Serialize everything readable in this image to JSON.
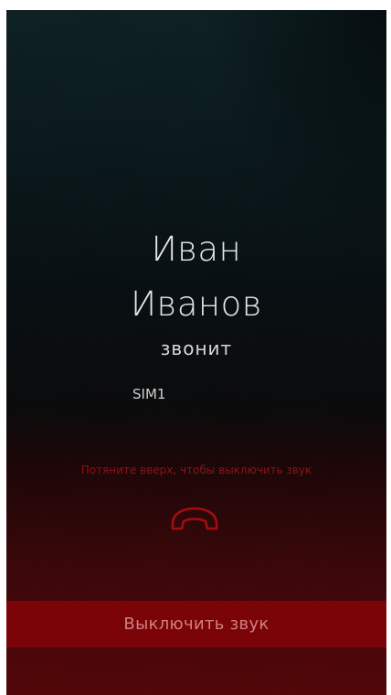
{
  "caller": {
    "first_name": "Иван",
    "last_name": "Иванов",
    "status": "звонит",
    "sim": "SIM1"
  },
  "gesture": {
    "hint": "Потяните вверх, чтобы выключить звук",
    "icon": "phone-hangup-icon"
  },
  "actions": {
    "mute_label": "Выключить звук"
  },
  "colors": {
    "accent_red": "#7a0407",
    "hint_red": "#8a1418",
    "icon_red": "#a30d12"
  }
}
